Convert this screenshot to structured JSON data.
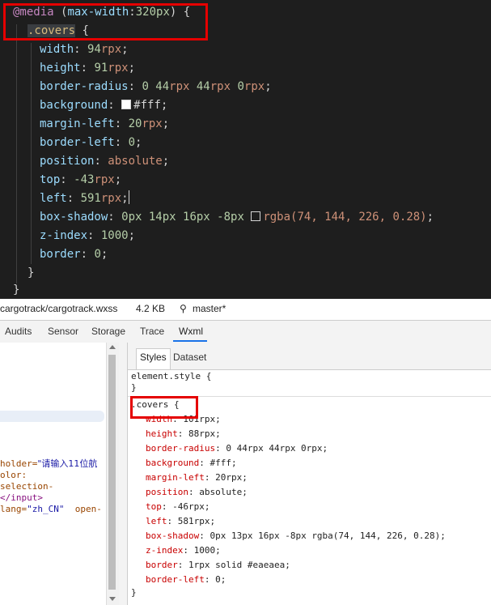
{
  "editor": {
    "media_keyword": "@media",
    "media_query_feature": "max-width",
    "media_query_value": "320px",
    "selector": ".covers",
    "declarations": [
      {
        "prop": "width",
        "num": "94",
        "unit": "rpx"
      },
      {
        "prop": "height",
        "num": "91",
        "unit": "rpx"
      },
      {
        "prop": "border-radius",
        "num": "0 44",
        "unit": "rpx 44rpx 0rpx"
      },
      {
        "prop": "background",
        "value": "#fff"
      },
      {
        "prop": "margin-left",
        "num": "20",
        "unit": "rpx"
      },
      {
        "prop": "border-left",
        "num": "0",
        "unit": ""
      },
      {
        "prop": "position",
        "value": "absolute"
      },
      {
        "prop": "top",
        "num": "-43",
        "unit": "rpx"
      },
      {
        "prop": "left",
        "num": "591",
        "unit": "rpx"
      },
      {
        "prop": "box-shadow",
        "value": "0px 14px 16px -8px",
        "color": "rgba(74, 144, 226, 0.28)"
      },
      {
        "prop": "z-index",
        "num": "1000",
        "unit": ""
      },
      {
        "prop": "border",
        "num": "0",
        "unit": ""
      }
    ]
  },
  "statusbar": {
    "file_path": "cargotrack/cargotrack.wxss",
    "file_size": "4.2 KB",
    "branch": "master*"
  },
  "devtools_tabs": [
    "Audits",
    "Sensor",
    "Storage",
    "Trace",
    "Wxml"
  ],
  "devtools_active_tab": "Wxml",
  "left_pane": {
    "lines": [
      {
        "attr": "holder=",
        "str": "\"请输入11位航"
      },
      {
        "txt": "olor:"
      },
      {
        "txt": "selection-"
      },
      {
        "tag": "</input>"
      },
      {
        "attr": "lang=",
        "str": "\"zh_CN\"",
        "txt": "  open-"
      }
    ]
  },
  "styles_panel": {
    "tabs": [
      "Styles",
      "Dataset"
    ],
    "active_tab": "Styles",
    "element_style_open": "element.style {",
    "element_style_close": "}",
    "rule_selector": ".covers {",
    "rule_close": "}",
    "declarations": [
      {
        "prop": "width",
        "value": "101rpx;"
      },
      {
        "prop": "height",
        "value": "88rpx;"
      },
      {
        "prop": "border-radius",
        "value": "0 44rpx 44rpx 0rpx;"
      },
      {
        "prop": "background",
        "value": "#fff;"
      },
      {
        "prop": "margin-left",
        "value": "20rpx;"
      },
      {
        "prop": "position",
        "value": "absolute;"
      },
      {
        "prop": "top",
        "value": "-46rpx;"
      },
      {
        "prop": "left",
        "value": "581rpx;"
      },
      {
        "prop": "box-shadow",
        "value": "0px 13px 16px -8px rgba(74, 144, 226, 0.28);"
      },
      {
        "prop": "z-index",
        "value": "1000;"
      },
      {
        "prop": "border",
        "value": "1rpx solid #eaeaea;"
      },
      {
        "prop": "border-left",
        "value": "0;"
      }
    ]
  },
  "colors": {
    "editor_bg": "#1e1e1e",
    "highlight_box": "#e50000",
    "shadow_swatch": "rgba(74, 144, 226, 0.28)"
  }
}
